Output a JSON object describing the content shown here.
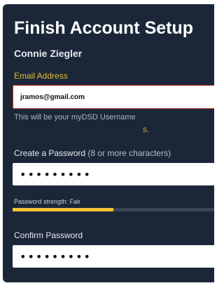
{
  "form": {
    "title": "Finish Account Setup",
    "user_name": "Connie Ziegler",
    "email": {
      "label": "Email Address",
      "value": "jramos@gmail.com",
      "help": "This will be your myDSD Username",
      "stray_char": "S."
    },
    "password": {
      "label": "Create a Password",
      "hint": "(8 or more characters)",
      "value": "•••••••••"
    },
    "strength": {
      "label": "Password strength: Fair",
      "fraction": 0.48,
      "fill_color": "#f2c230"
    },
    "confirm": {
      "label": "Confirm Password",
      "value": "•••••••••"
    }
  }
}
